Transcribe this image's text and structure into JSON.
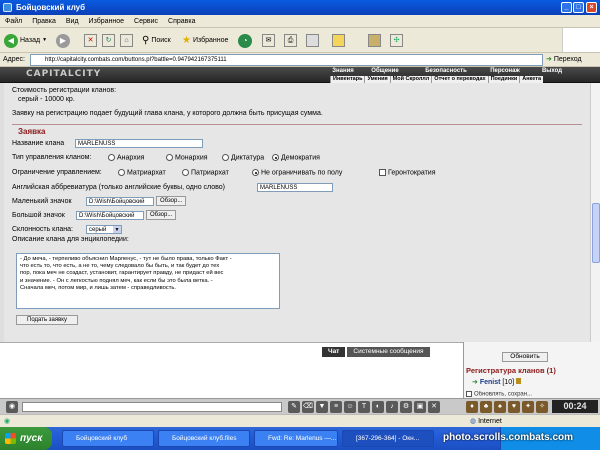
{
  "window": {
    "title": "Бойцовский клуб",
    "min": "_",
    "max": "□",
    "close": "×"
  },
  "menu": [
    "Файл",
    "Правка",
    "Вид",
    "Избранное",
    "Сервис",
    "Справка"
  ],
  "toolbar": {
    "back": "Назад",
    "search": "Поиск",
    "favorites": "Избранное"
  },
  "address": {
    "label": "Адрес:",
    "url": "http://capitalcity.combats.com/buttons.pl?battle=0.947942167375111",
    "go": "Переход"
  },
  "site": {
    "logo": "CAPITALCITY",
    "nav": [
      "Знания",
      "Общение",
      "Безопасность",
      "Персонаж",
      "Выход"
    ],
    "subnav": [
      "Инвентарь",
      "Умения",
      "Мой Скроллл",
      "Отчет о переводах",
      "Поединки",
      "Анкета"
    ]
  },
  "form": {
    "intro1": "Стоимость регистрации кланов:",
    "intro2": "серый - 10000 кр.",
    "intro3": "Заявку на регистрацию подает будущий глава клана, у которого должна быть присущая сумма.",
    "section_title": "Заявка",
    "clan_name_label": "Название клана",
    "clan_name_value": "MARLENUSS",
    "mgmt_label": "Тип управления кланом:",
    "mgmt_options": [
      "Анархия",
      "Монархия",
      "Диктатура",
      "Демократия"
    ],
    "restrict_label": "Ограничение управлением:",
    "restrict_options": [
      "Матриархат",
      "Патриархат",
      "Не ограничивать по полу",
      "Геронтократия"
    ],
    "abbr_label": "Английская аббревиатура (только английские буквы, одно слово)",
    "abbr_value": "MARLENUSS",
    "small_icon_label": "Маленький значок",
    "small_icon_value": "D:\\Wish\\Бойцовский",
    "big_icon_label": "Большой значок",
    "big_icon_value": "D:\\Wish\\Бойцовский",
    "browse": "Обзор...",
    "align_label": "Склонность клана:",
    "align_value": "серый",
    "desc_label": "Описание клана для энциклопедии:",
    "desc_text": "- До меча, - терпеливо объяснил Марленус, - тут не было права, только Факт -\nчто есть то, что есть, а не то, чему следовало бы быть, и так будет до тех\nпор, пока меч не создаст, установит, гарантирует правду, не придаст ей вес\nи значение. - Он с легкостью поднял меч, как если бы это была ветка. -\nСначала меч, потом мир, и лишь затем - справедливость.",
    "submit": "Подать заявку"
  },
  "chat": {
    "tabs": [
      "Чат",
      "Системные сообщения"
    ]
  },
  "right_panel": {
    "refresh": "Обновить",
    "title": "Регистратура кланов (1)",
    "player": "Fenist",
    "level": "[10]",
    "bottom_text": "Обновлять, сохран..."
  },
  "clock": "00:24",
  "statusbar": {
    "zone": "Internet"
  },
  "taskbar": {
    "start": "пуск",
    "tasks": [
      "Бойцовский клуб",
      "Бойцовский клуб.files",
      "Fwd: Re: Marlenus —...",
      "[367-296-364] - Окн..."
    ]
  },
  "watermark": "photo.scrolls.combats.com"
}
